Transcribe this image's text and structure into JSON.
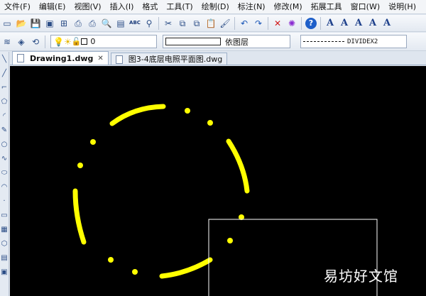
{
  "menu": [
    {
      "id": "file",
      "label": "文件(F)"
    },
    {
      "id": "edit",
      "label": "编辑(E)"
    },
    {
      "id": "view",
      "label": "视图(V)"
    },
    {
      "id": "insert",
      "label": "插入(I)"
    },
    {
      "id": "format",
      "label": "格式"
    },
    {
      "id": "tools",
      "label": "工具(T)"
    },
    {
      "id": "draw",
      "label": "绘制(D)"
    },
    {
      "id": "dimension",
      "label": "标注(N)"
    },
    {
      "id": "modify",
      "label": "修改(M)"
    },
    {
      "id": "extend",
      "label": "拓展工具"
    },
    {
      "id": "window",
      "label": "窗口(W)"
    },
    {
      "id": "help",
      "label": "说明(H)"
    }
  ],
  "toolbar": {
    "spell_label": "ABC",
    "text_a": "A"
  },
  "layer_bar": {
    "current_layer": "0",
    "color_label": "依图层",
    "linetype_label": "DIVIDEX2"
  },
  "tabs": [
    {
      "label": "Drawing1.dwg",
      "active": true,
      "close": "✕"
    },
    {
      "label": "图3-4底层电照平面图.dwg",
      "active": false
    }
  ],
  "canvas": {
    "background": "#000000",
    "entity_color": "#ffff00",
    "frame_color": "#ffffff"
  },
  "watermark": "易坊好文馆"
}
